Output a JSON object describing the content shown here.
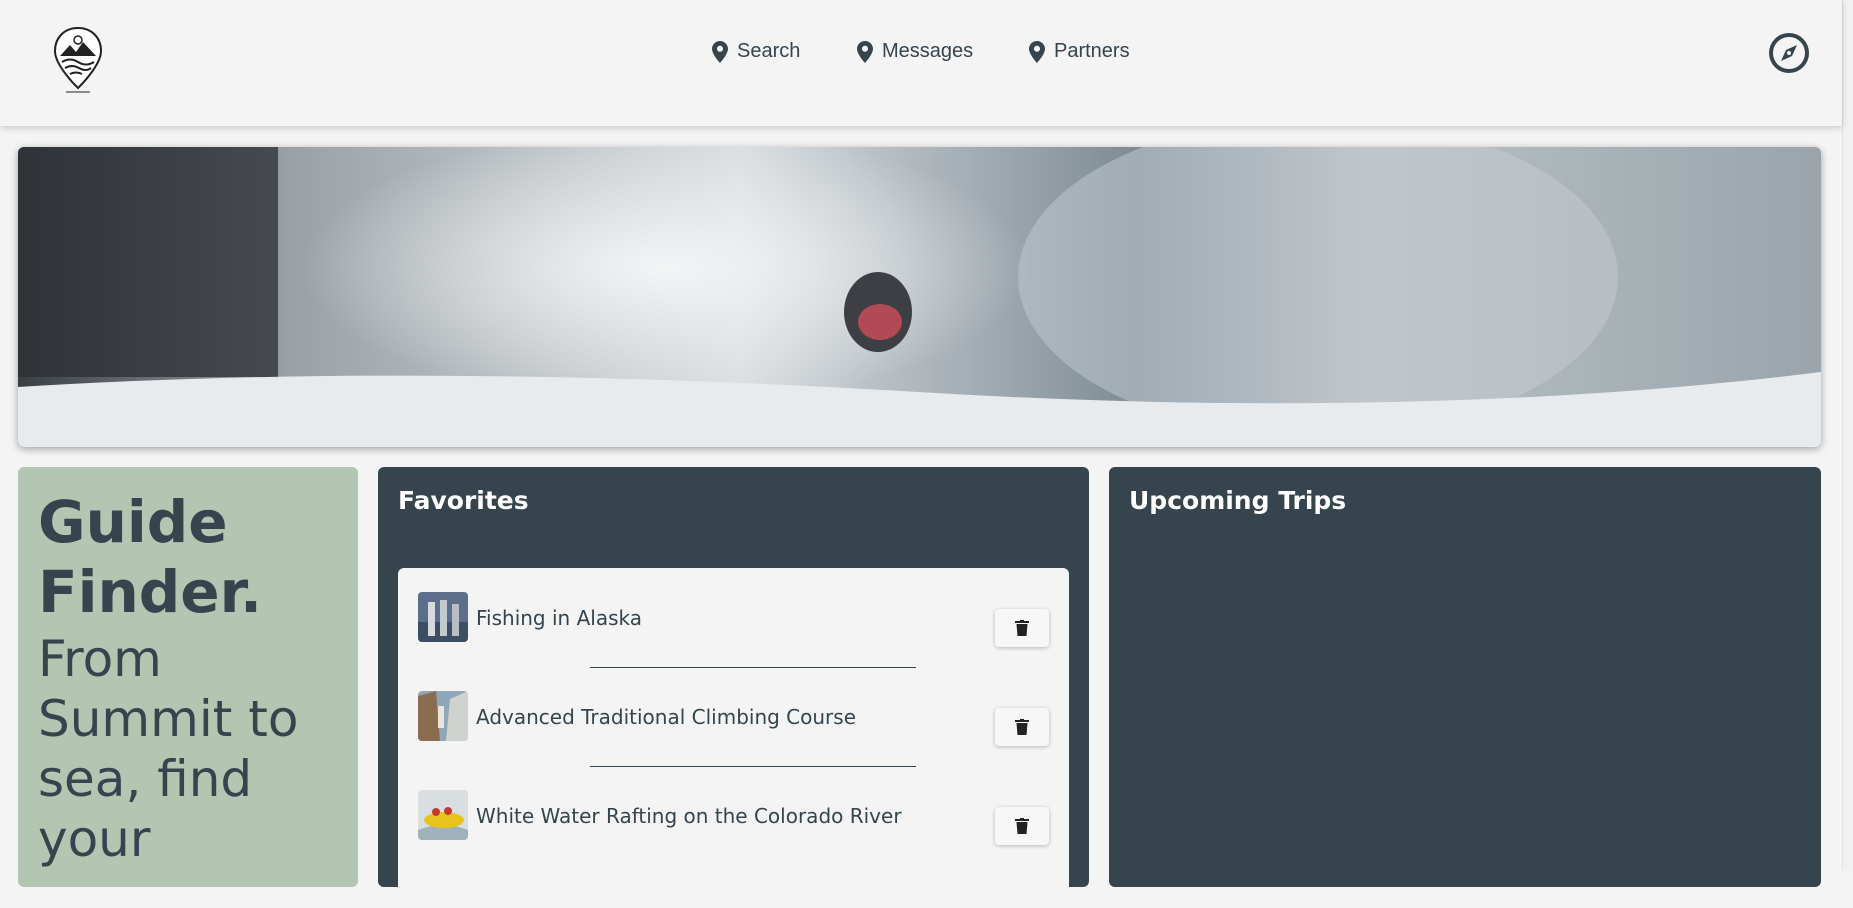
{
  "nav": {
    "links": [
      {
        "label": "Search",
        "icon": "map-pin-icon"
      },
      {
        "label": "Messages",
        "icon": "map-pin-icon"
      },
      {
        "label": "Partners",
        "icon": "map-pin-icon"
      }
    ],
    "right_icon": "compass-icon",
    "logo_icon": "map-pin-logo-icon"
  },
  "hero": {
    "image": "snowboarder-powder-spray"
  },
  "intro": {
    "title": "Guide Finder.",
    "subtitle": "From Summit to sea, find your"
  },
  "favorites": {
    "title": "Favorites",
    "items": [
      {
        "label": "Fishing in Alaska",
        "thumb": "fishing-photo",
        "action_icon": "trash-icon"
      },
      {
        "label": "Advanced Traditional Climbing Course",
        "thumb": "climbing-photo",
        "action_icon": "trash-icon"
      },
      {
        "label": "White Water Rafting on the Colorado River",
        "thumb": "rafting-photo",
        "action_icon": "trash-icon"
      }
    ]
  },
  "trips": {
    "title": "Upcoming Trips"
  },
  "colors": {
    "background": "#f4f4f4",
    "dark_panel": "#35444d",
    "sage_panel": "#b3c6b2",
    "text": "#35444d"
  }
}
